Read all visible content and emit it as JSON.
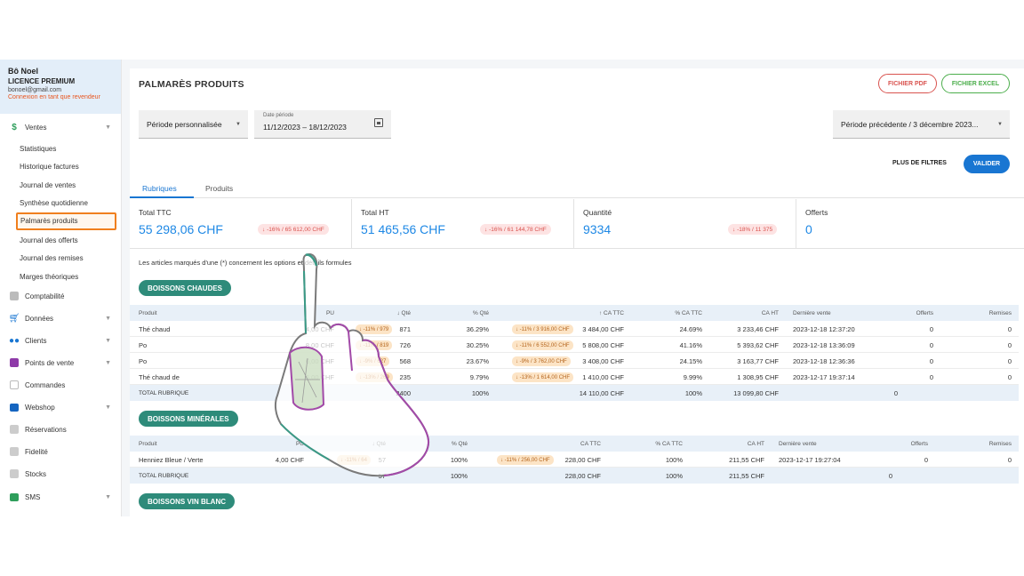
{
  "user": {
    "name": "Bô Noel",
    "license": "LICENCE PREMIUM",
    "email": "bonoel@gmail.com",
    "reseller": "Connexion en tant que revendeur"
  },
  "sidebar": {
    "ventes": "Ventes",
    "sub_items": [
      "Statistiques",
      "Historique factures",
      "Journal de ventes",
      "Synthèse quotidienne",
      "Palmarès produits",
      "Journal des offerts",
      "Journal des remises",
      "Marges théoriques"
    ],
    "items": [
      "Comptabilité",
      "Données",
      "Clients",
      "Points de vente",
      "Commandes",
      "Webshop",
      "Réservations",
      "Fidelité",
      "Stocks",
      "SMS"
    ]
  },
  "header": {
    "title": "PALMARÈS PRODUITS",
    "pdf": "FICHIER PDF",
    "excel": "FICHIER EXCEL"
  },
  "filters": {
    "period": "Période personnalisée",
    "date_label": "Date période",
    "date_value": "11/12/2023 – 18/12/2023",
    "compare": "Période précédente / 3 décembre 2023...",
    "more": "PLUS DE FILTRES",
    "validate": "VALIDER"
  },
  "tabs": [
    "Rubriques",
    "Produits"
  ],
  "kpis": [
    {
      "label": "Total TTC",
      "value": "55 298,06 CHF",
      "badge": "-16% / 65 612,00 CHF"
    },
    {
      "label": "Total HT",
      "value": "51 465,56 CHF",
      "badge": "-16% / 61 144,78 CHF"
    },
    {
      "label": "Quantité",
      "value": "9334",
      "badge": "-18% / 11 375"
    },
    {
      "label": "Offerts",
      "value": "0"
    }
  ],
  "note": "Les articles marqués d'une (*) concernent les options et détails formules",
  "table_headers": {
    "produit": "Produit",
    "pu": "PU",
    "qte": "Qté",
    "pqte": "% Qté",
    "ca_ttc": "CA TTC",
    "pca_ttc": "% CA TTC",
    "ca_ht": "CA HT",
    "derniere": "Dernière vente",
    "offerts": "Offerts",
    "remises": "Remises",
    "total": "TOTAL RUBRIQUE"
  },
  "categories": [
    {
      "name": "BOISSONS CHAUDES",
      "rows": [
        {
          "produit": "Thé chaud",
          "pu": "4,00 CHF",
          "qte_pill": "-11% / 979",
          "qte": "871",
          "pqte": "36.29%",
          "ca_pill": "-11% / 3 916,00 CHF",
          "ca_ttc": "3 484,00 CHF",
          "pca": "24.69%",
          "ca_ht": "3 233,46 CHF",
          "derniere": "2023-12-18 12:37:20",
          "offerts": "0",
          "remises": "0"
        },
        {
          "produit": "Po",
          "pu": "8,00 CHF",
          "qte_pill": "-11% / 819",
          "qte": "726",
          "pqte": "30.25%",
          "ca_pill": "-11% / 6 552,00 CHF",
          "ca_ttc": "5 808,00 CHF",
          "pca": "41.16%",
          "ca_ht": "5 393,62 CHF",
          "derniere": "2023-12-18 13:36:09",
          "offerts": "0",
          "remises": "0"
        },
        {
          "produit": "Po",
          "pu": "6,00 CHF",
          "qte_pill": "-9% / 627",
          "qte": "568",
          "pqte": "23.67%",
          "ca_pill": "-9% / 3 762,00 CHF",
          "ca_ttc": "3 408,00 CHF",
          "pca": "24.15%",
          "ca_ht": "3 163,77 CHF",
          "derniere": "2023-12-18 12:36:36",
          "offerts": "0",
          "remises": "0"
        },
        {
          "produit": "Thé chaud de",
          "pu": "6,00 CHF",
          "qte_pill": "-13% / 269",
          "qte": "235",
          "pqte": "9.79%",
          "ca_pill": "-13% / 1 614,00 CHF",
          "ca_ttc": "1 410,00 CHF",
          "pca": "9.99%",
          "ca_ht": "1 308,95 CHF",
          "derniere": "2023-12-17 19:37:14",
          "offerts": "0",
          "remises": "0"
        }
      ],
      "total": {
        "qte": "2400",
        "pqte": "100%",
        "ca_ttc": "14 110,00 CHF",
        "pca": "100%",
        "ca_ht": "13 099,80 CHF",
        "offerts": "0"
      }
    },
    {
      "name": "BOISSONS MINÉRALES",
      "rows": [
        {
          "produit": "Henniez Bleue / Verte",
          "pu": "4,00 CHF",
          "qte_pill": "-11% / 64",
          "qte": "57",
          "pqte": "100%",
          "ca_pill": "-11% / 256,00 CHF",
          "ca_ttc": "228,00 CHF",
          "pca": "100%",
          "ca_ht": "211,55 CHF",
          "derniere": "2023-12-17 19:27:04",
          "offerts": "0",
          "remises": "0"
        }
      ],
      "total": {
        "qte": "57",
        "pqte": "100%",
        "ca_ttc": "228,00 CHF",
        "pca": "100%",
        "ca_ht": "211,55 CHF",
        "offerts": "0"
      }
    },
    {
      "name": "BOISSONS VIN BLANC"
    }
  ],
  "colors": {
    "primary": "#1976d2",
    "category": "#2e8b7a",
    "highlight": "#f07f1e"
  }
}
